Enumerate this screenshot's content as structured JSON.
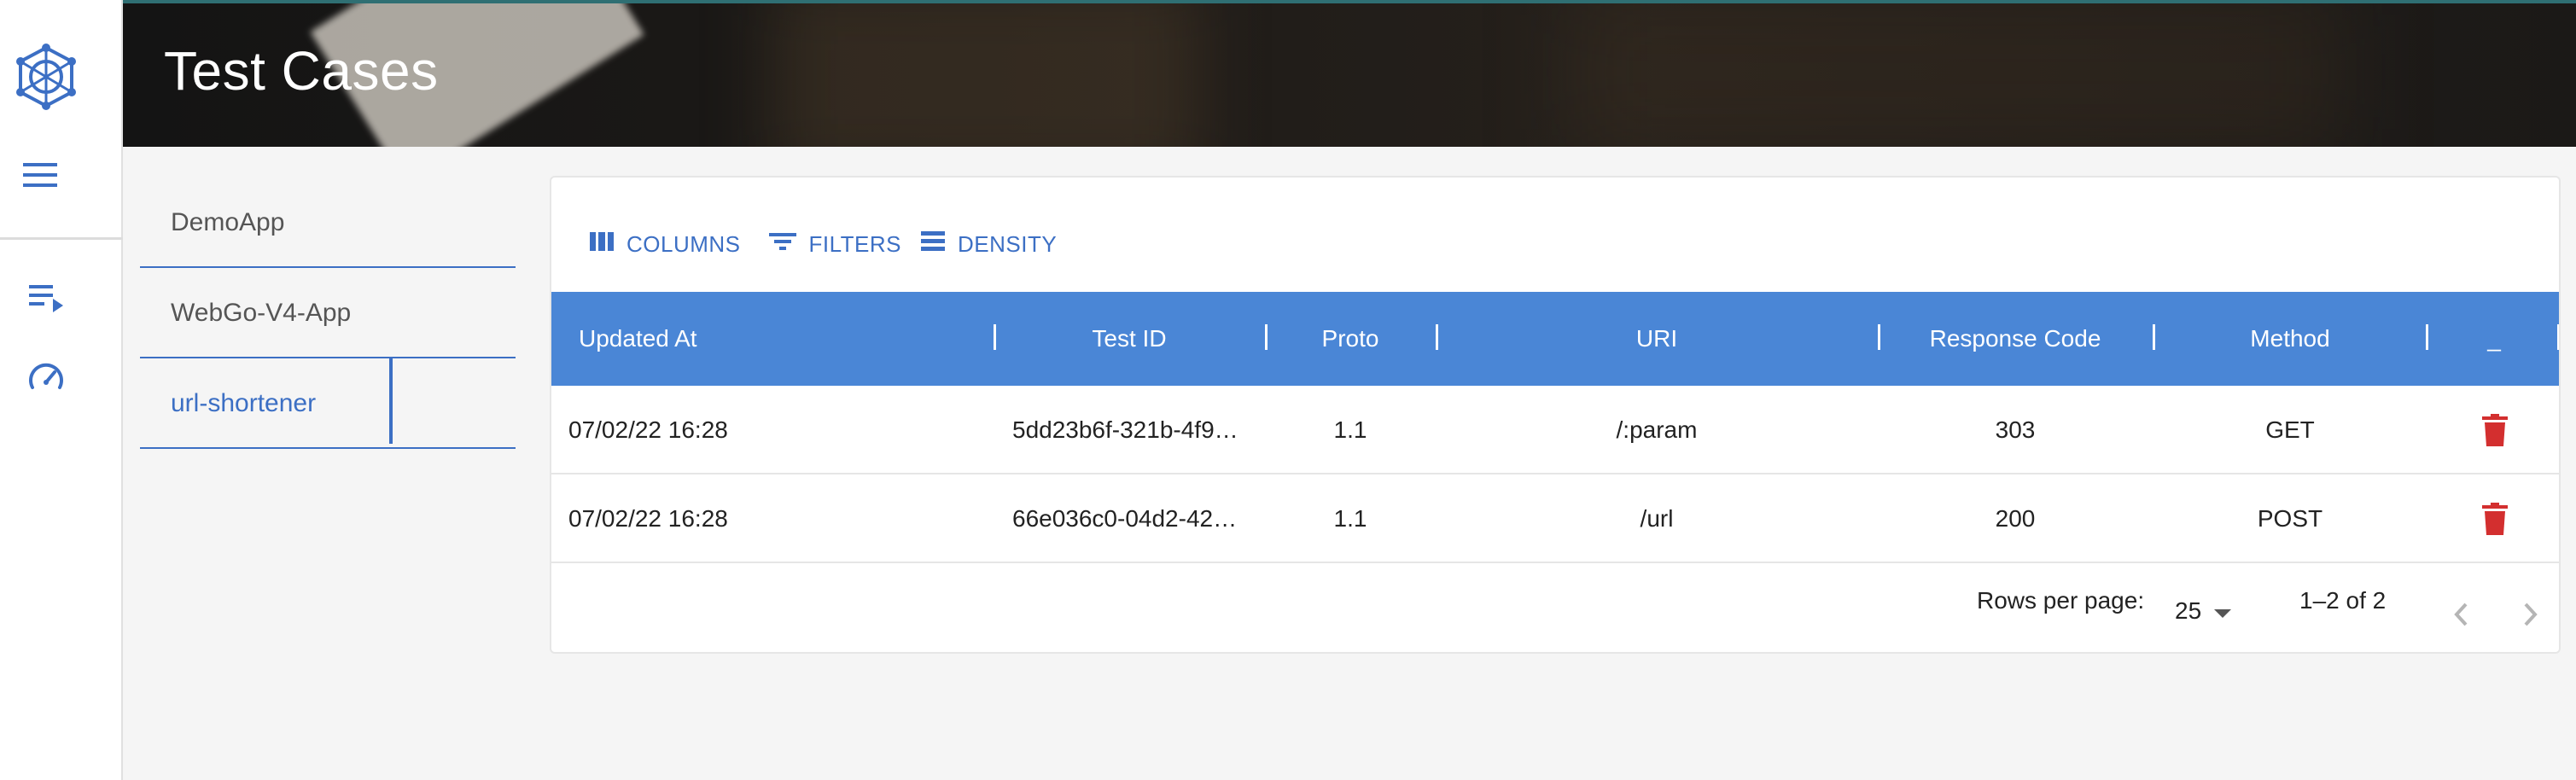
{
  "header": {
    "title": "Test Cases"
  },
  "rail": {
    "logo_icon": "network-globe-icon",
    "menu_icon": "hamburger-menu-icon",
    "nav": [
      {
        "icon": "playlist-play-icon",
        "label": "Test Cases"
      },
      {
        "icon": "speedometer-icon",
        "label": "Dashboard"
      }
    ]
  },
  "apps": {
    "items": [
      {
        "label": "DemoApp"
      },
      {
        "label": "WebGo-V4-App"
      },
      {
        "label": "url-shortener"
      }
    ],
    "active": "url-shortener"
  },
  "toolbar": {
    "columns_label": "COLUMNS",
    "filters_label": "FILTERS",
    "density_label": "DENSITY"
  },
  "table": {
    "headers": {
      "updated_at": "Updated At",
      "test_id": "Test ID",
      "proto": "Proto",
      "uri": "URI",
      "response_code": "Response Code",
      "method": "Method",
      "actions": "_"
    },
    "rows": [
      {
        "updated_at": "07/02/22 16:28",
        "test_id": "5dd23b6f-321b-4f9…",
        "proto": "1.1",
        "uri": "/:param",
        "response_code": "303",
        "method": "GET"
      },
      {
        "updated_at": "07/02/22 16:28",
        "test_id": "66e036c0-04d2-42…",
        "proto": "1.1",
        "uri": "/url",
        "response_code": "200",
        "method": "POST"
      }
    ]
  },
  "pagination": {
    "rows_per_page_label": "Rows per page:",
    "rows_per_page_value": "25",
    "range_label": "1–2 of 2"
  },
  "colors": {
    "accent": "#3c6fc4",
    "table_header": "#4a86d6",
    "delete": "#d32f2f"
  }
}
